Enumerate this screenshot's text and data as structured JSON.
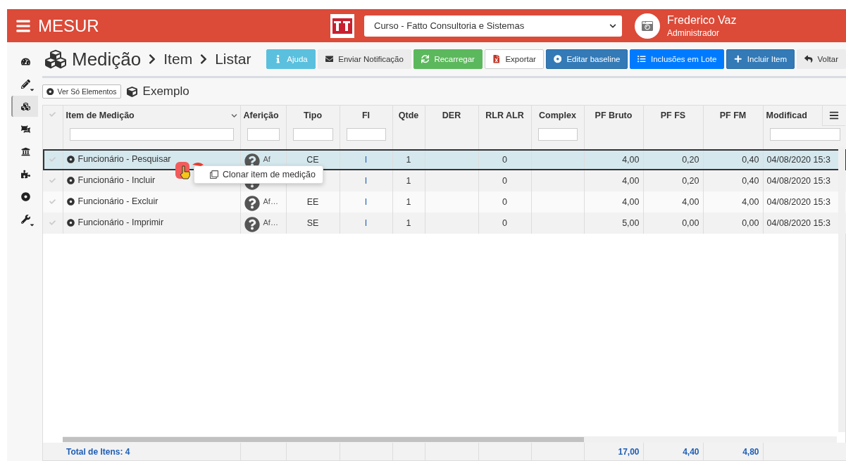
{
  "header": {
    "app_name": "MESUR",
    "project_select": "Curso - Fatto Consultoria e Sistemas",
    "user_name": "Frederico Vaz",
    "user_role": "Administrador"
  },
  "sidebar": {
    "items": [
      {
        "selected": false,
        "caret": false
      },
      {
        "selected": false,
        "caret": true
      },
      {
        "selected": true,
        "caret": false
      },
      {
        "selected": false,
        "caret": false
      },
      {
        "selected": false,
        "caret": false
      },
      {
        "selected": false,
        "caret": false
      },
      {
        "selected": false,
        "caret": false
      },
      {
        "selected": false,
        "caret": true
      }
    ]
  },
  "breadcrumb": [
    "Medição",
    "Item",
    "Listar"
  ],
  "toolbar": [
    {
      "label": "Ajuda",
      "kind": "info"
    },
    {
      "label": "Enviar Notificação",
      "kind": "light"
    },
    {
      "label": "Recarregar",
      "kind": "success"
    },
    {
      "label": "Exportar",
      "kind": "outline"
    },
    {
      "label": "Editar baseline",
      "kind": "primary"
    },
    {
      "label": "Inclusões em Lote",
      "kind": "bright"
    },
    {
      "label": "Incluir Item",
      "kind": "primary"
    },
    {
      "label": "Voltar",
      "kind": "light"
    }
  ],
  "filter_button": "Ver Só Elementos",
  "context_name": "Exemplo",
  "table": {
    "columns": [
      {
        "label": "Item de Medição",
        "filter": true
      },
      {
        "label": "Aferição",
        "filter": true
      },
      {
        "label": "Tipo",
        "filter": true
      },
      {
        "label": "FI",
        "filter": true
      },
      {
        "label": "Qtde"
      },
      {
        "label": "DER"
      },
      {
        "label": "RLR ALR"
      },
      {
        "label": "Complex",
        "filter": true
      },
      {
        "label": "PF Bruto"
      },
      {
        "label": "PF FS"
      },
      {
        "label": "PF FM"
      },
      {
        "label": "Modificad",
        "filter": true
      }
    ],
    "rows": [
      {
        "selected": true,
        "item": "Funcionário - Pesquisar",
        "afericao": "Af",
        "tipo": "CE",
        "fi": "I",
        "qtde": "1",
        "rlr_alr": "0",
        "pf_bruto": "4,00",
        "pf_fs": "0,20",
        "pf_fm": "0,40",
        "modificado": "04/08/2020 15:3"
      },
      {
        "selected": false,
        "item": "Funcionário - Incluir",
        "fi": "I",
        "qtde": "1",
        "rlr_alr": "0",
        "pf_bruto": "4,00",
        "pf_fs": "0,20",
        "pf_fm": "0,40",
        "modificado": "04/08/2020 15:3"
      },
      {
        "selected": false,
        "item": "Funcionário - Excluir",
        "afericao": "Af…",
        "tipo": "EE",
        "fi": "I",
        "qtde": "1",
        "rlr_alr": "0",
        "pf_bruto": "4,00",
        "pf_fs": "4,00",
        "pf_fm": "4,00",
        "modificado": "04/08/2020 15:3"
      },
      {
        "selected": false,
        "item": "Funcionário - Imprimir",
        "afericao": "Af…",
        "tipo": "SE",
        "fi": "I",
        "qtde": "1",
        "rlr_alr": "0",
        "pf_bruto": "5,00",
        "pf_fs": "0,00",
        "pf_fm": "0,00",
        "modificado": "04/08/2020 15:3"
      }
    ],
    "footer": {
      "total": "Total de Itens: 4",
      "pf_bruto": "17,00",
      "pf_fs": "4,40",
      "pf_fm": "4,80"
    }
  },
  "context_menu": {
    "items": [
      "Clonar item de medição"
    ]
  }
}
